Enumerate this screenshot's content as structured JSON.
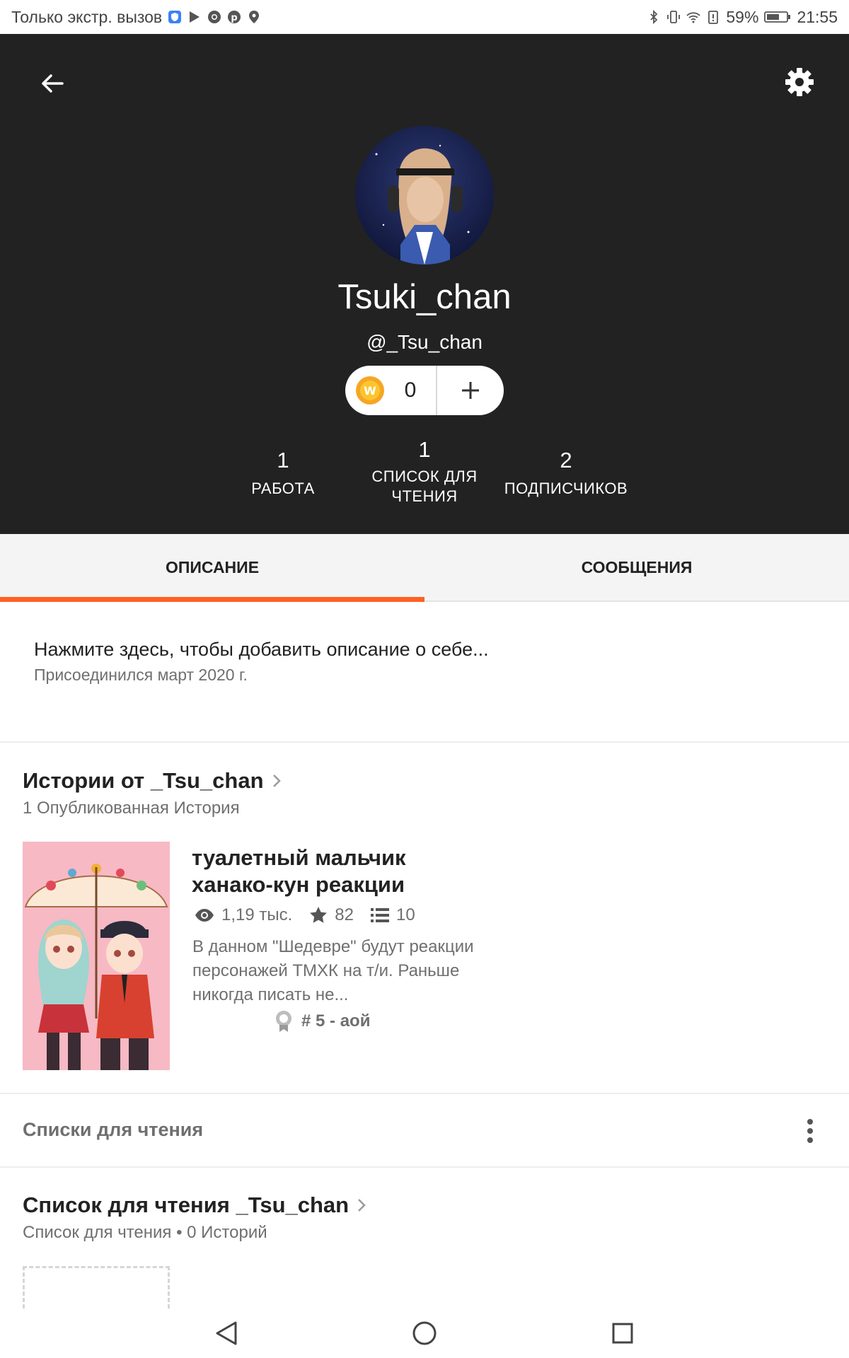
{
  "status_bar": {
    "carrier_text": "Только экстр. вызов",
    "battery": "59%",
    "time": "21:55"
  },
  "profile": {
    "display_name": "Tsuki_chan",
    "username": "@_Tsu_chan",
    "coins": "0"
  },
  "stats": [
    {
      "value": "1",
      "label": "РАБОТА"
    },
    {
      "value": "1",
      "label": "СПИСОК ДЛЯ ЧТЕНИЯ"
    },
    {
      "value": "2",
      "label": "ПОДПИСЧИКОВ"
    }
  ],
  "tabs": [
    {
      "label": "ОПИСАНИЕ",
      "active": true
    },
    {
      "label": "СООБЩЕНИЯ",
      "active": false
    }
  ],
  "about": {
    "prompt": "Нажмите здесь, чтобы добавить описание о себе...",
    "joined": "Присоединился март 2020 г."
  },
  "stories_section": {
    "title": "Истории от _Tsu_chan",
    "subtitle": "1 Опубликованная История"
  },
  "story": {
    "title": "туалетный мальчик ханако-кун реакции",
    "reads": "1,19 тыс.",
    "votes": "82",
    "parts": "10",
    "description": "В данном \"Шедевре\" будут реакции персонажей ТМХК на т/и. Раньше никогда писать не...",
    "rank": "# 5 - аой"
  },
  "reading_lists_header": {
    "title": "Списки для чтения"
  },
  "reading_list": {
    "title": "Список для чтения _Tsu_chan",
    "subtitle": "Список для чтения • 0 Историй"
  },
  "colors": {
    "header_bg": "#222222",
    "accent": "#ff6122",
    "tab_bg": "#f4f4f4",
    "muted_text": "#6f6f6f"
  }
}
